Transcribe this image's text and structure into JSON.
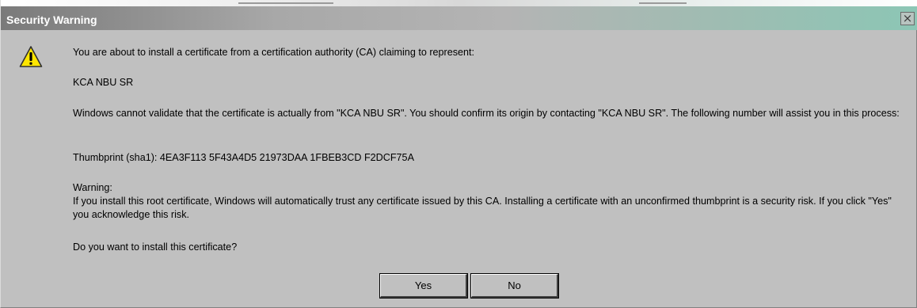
{
  "window": {
    "title": "Security Warning",
    "close_symbol": "×"
  },
  "icons": {
    "warning": "warning-triangle-icon",
    "close": "close-icon"
  },
  "message": {
    "intro": "You are about to install a certificate from a certification authority (CA) claiming to represent:",
    "ca_name": "KCA NBU SR",
    "validate": "Windows cannot validate that the certificate is actually from \"KCA NBU SR\". You should confirm its origin by contacting \"KCA NBU SR\". The following number will assist you in this process:",
    "thumbprint": "Thumbprint (sha1): 4EA3F113 5F43A4D5 21973DAA 1FBEB3CD F2DCF75A",
    "warning_label": "Warning:",
    "warning_text": "If you install this root certificate, Windows will automatically trust any certificate issued by this CA. Installing a certificate with an unconfirmed thumbprint is a security risk. If you click \"Yes\" you acknowledge this risk.",
    "question": "Do you want to install this certificate?"
  },
  "buttons": {
    "yes": "Yes",
    "no": "No"
  },
  "colors": {
    "dialog_background": "#c0c0c0",
    "title_text": "#ffffff",
    "warning_icon_fill": "#ffe600"
  }
}
